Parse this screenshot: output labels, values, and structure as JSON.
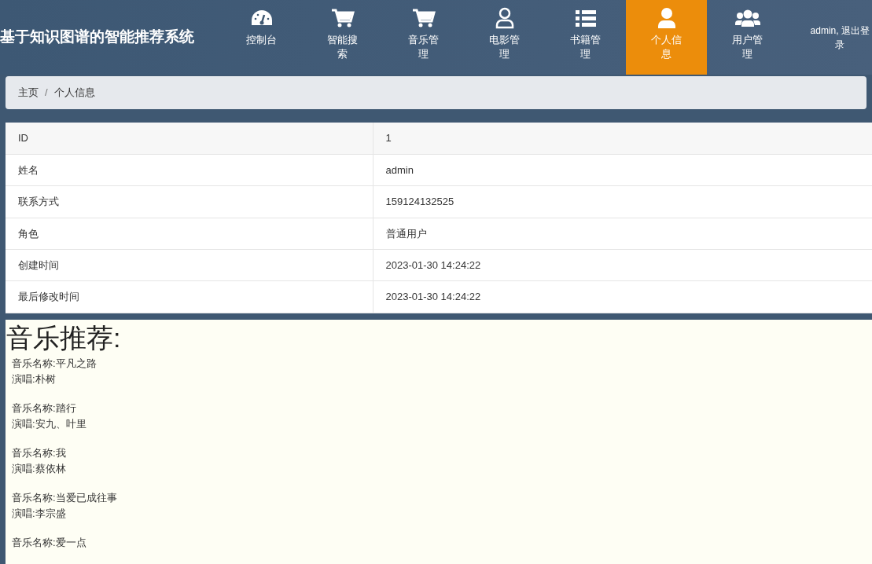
{
  "header": {
    "title": "基于知识图谱的智能推荐系统",
    "user": "admin, 退出登录"
  },
  "nav": [
    {
      "label": "控制台",
      "kind": "gauge",
      "selected": false
    },
    {
      "label": "智能搜索",
      "kind": "cart",
      "selected": false
    },
    {
      "label": "音乐管理",
      "kind": "cart",
      "selected": false
    },
    {
      "label": "电影管理",
      "kind": "person-outline",
      "selected": false
    },
    {
      "label": "书籍管理",
      "kind": "list",
      "selected": false
    },
    {
      "label": "个人信息",
      "kind": "person",
      "selected": true
    },
    {
      "label": "用户管理",
      "kind": "group",
      "selected": false
    }
  ],
  "breadcrumb": {
    "separator": "/",
    "items": [
      "主页",
      "个人信息"
    ]
  },
  "profile": [
    {
      "label": "ID",
      "value": "1"
    },
    {
      "label": "姓名",
      "value": "admin"
    },
    {
      "label": "联系方式",
      "value": "159124132525"
    },
    {
      "label": "角色",
      "value": "普通用户"
    },
    {
      "label": "创建时间",
      "value": "2023-01-30 14:24:22"
    },
    {
      "label": "最后修改时间",
      "value": "2023-01-30 14:24:22"
    }
  ],
  "recommendations": {
    "heading": "音乐推荐:",
    "items": [
      {
        "name": "音乐名称:平凡之路",
        "singer": "演唱:朴树"
      },
      {
        "name": "音乐名称:踏行",
        "singer": "演唱:安九、叶里"
      },
      {
        "name": "音乐名称:我",
        "singer": "演唱:蔡依林"
      },
      {
        "name": "音乐名称:当爱已成往事",
        "singer": "演唱:李宗盛"
      },
      {
        "name": "音乐名称:爱一点"
      }
    ]
  }
}
